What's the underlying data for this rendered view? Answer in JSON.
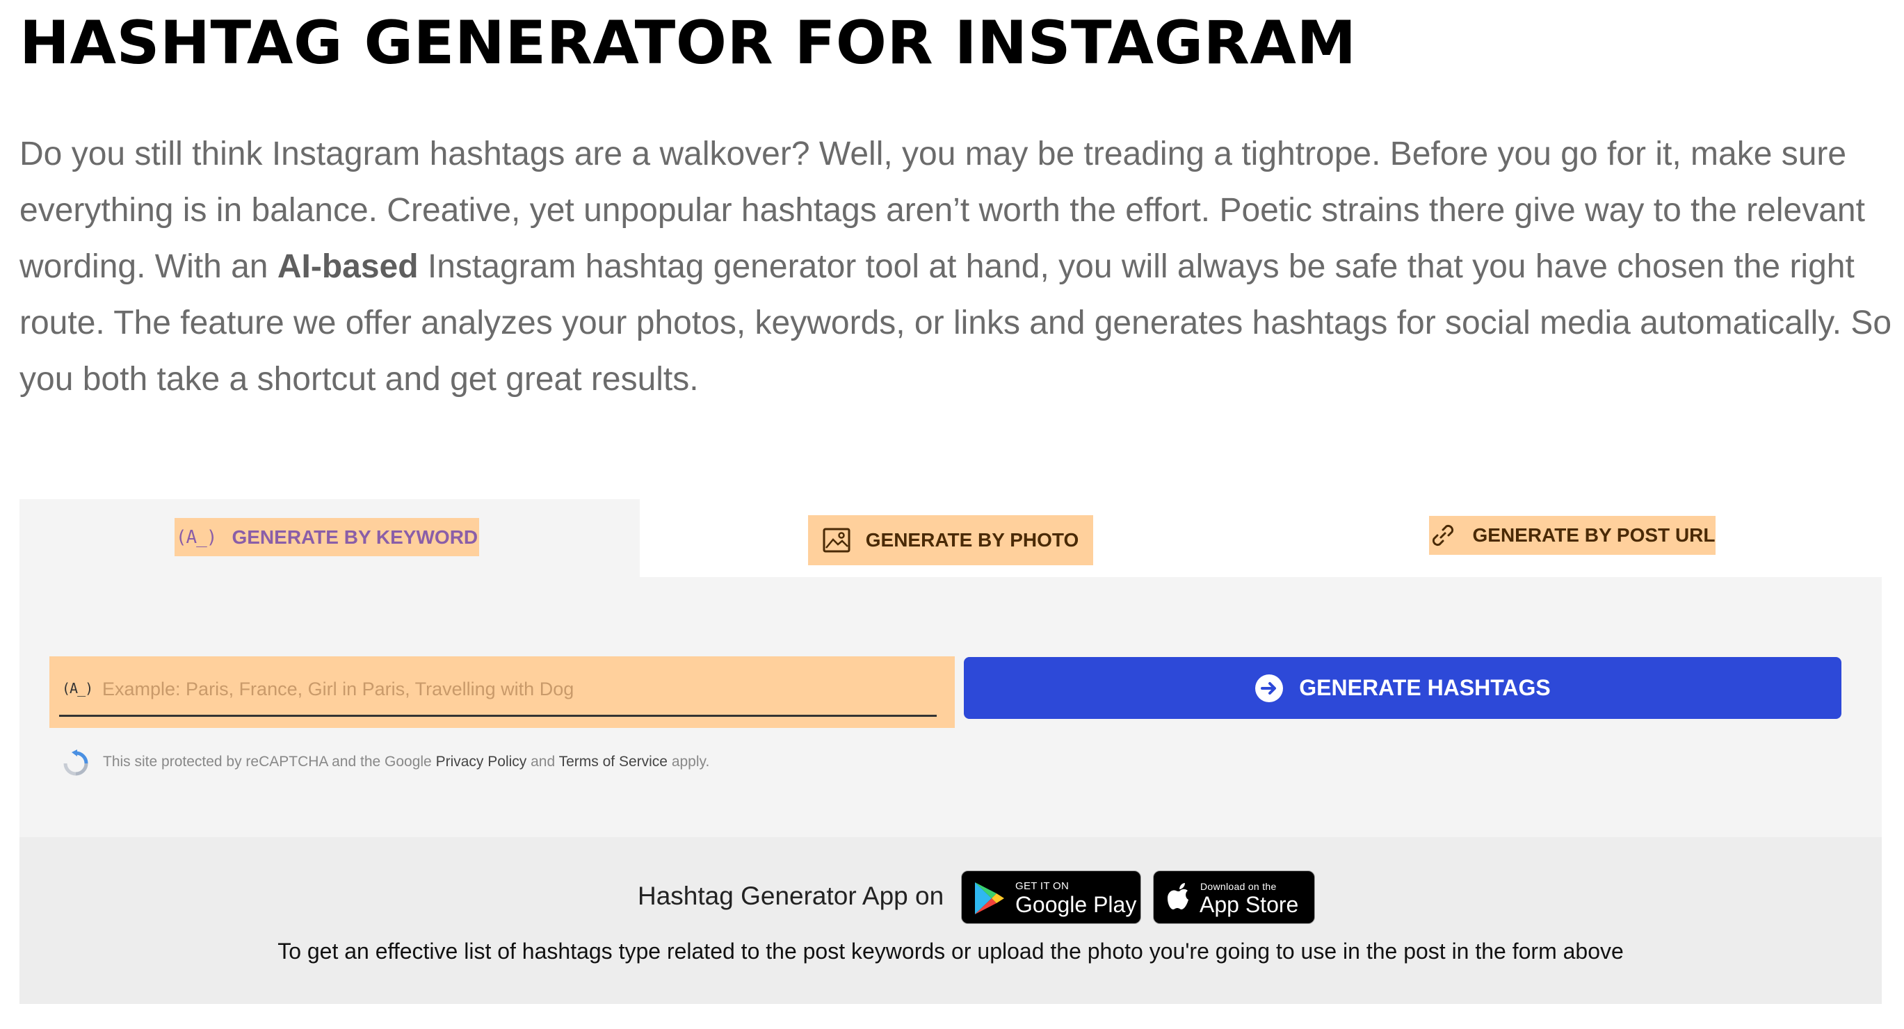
{
  "page": {
    "title": "HASHTAG GENERATOR FOR INSTAGRAM",
    "intro_before_bold": "Do you still think Instagram hashtags are a walkover? Well, you may be treading a tightrope. Before you go for it, make sure everything is in balance. Creative, yet unpopular hashtags aren’t worth the effort. Poetic strains there give way to the relevant wording. With an ",
    "intro_bold": "AI-based",
    "intro_after_bold": " Instagram hashtag generator tool at hand, you will always be safe that you have chosen the right route. The feature we offer analyzes your photos, keywords, or links and generates hashtags for social media automatically. So you both take a shortcut and get great results."
  },
  "tabs": [
    {
      "label": "GENERATE BY KEYWORD",
      "icon": "keyword-icon",
      "icon_glyph": "(A_)",
      "active": true
    },
    {
      "label": "GENERATE BY PHOTO",
      "icon": "image-icon",
      "active": false
    },
    {
      "label": "GENERATE BY POST URL",
      "icon": "link-icon",
      "active": false
    }
  ],
  "form": {
    "input_icon_glyph": "(A_)",
    "input_placeholder": "Example: Paris, France, Girl in Paris, Travelling with Dog",
    "input_value": "",
    "generate_button": "GENERATE HASHTAGS",
    "recaptcha": {
      "prefix": "This site protected by reCAPTCHA and the Google ",
      "privacy_link": "Privacy Policy",
      "and": " and ",
      "terms_link": "Terms of Service",
      "suffix": " apply."
    }
  },
  "app": {
    "label": "Hashtag Generator App on",
    "google_play": {
      "small": "GET IT ON",
      "big": "Google Play"
    },
    "app_store": {
      "small": "Download on the",
      "big": "App Store"
    },
    "help_text": "To get an effective list of hashtags type related to the post keywords or upload the photo you're going to use in the post in the form above"
  },
  "colors": {
    "tab_accent": "#ffd09c",
    "active_tab_text": "#8a5ea8",
    "primary_button": "#2d49d8",
    "panel_bg": "#f4f4f4",
    "app_bar_bg": "#ededed"
  }
}
